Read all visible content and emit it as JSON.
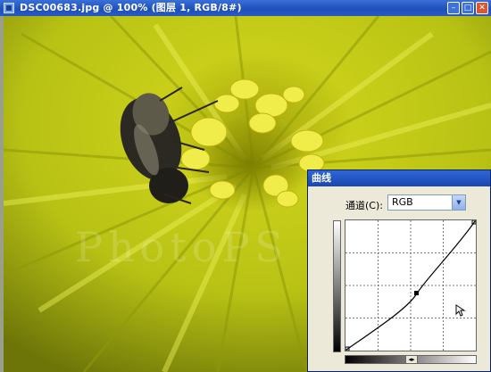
{
  "window": {
    "title": "DSC00683.jpg @ 100% (图层 1, RGB/8#)"
  },
  "canvas": {
    "watermark_text": "PhotoPS"
  },
  "curves_dialog": {
    "title": "曲线",
    "channel_label": "通道(C):",
    "channel_value": "RGB",
    "channel_options": [
      "RGB"
    ]
  },
  "icons": [
    "app-icon",
    "minimize-icon",
    "maximize-icon",
    "close-icon",
    "dropdown-arrow-icon",
    "toggle-arrows-icon",
    "mouse-cursor-icon"
  ],
  "colors": {
    "title_bar": "#245edb",
    "dialog_bg": "#ece9d8",
    "petal_yellow": "#c8d21e"
  }
}
